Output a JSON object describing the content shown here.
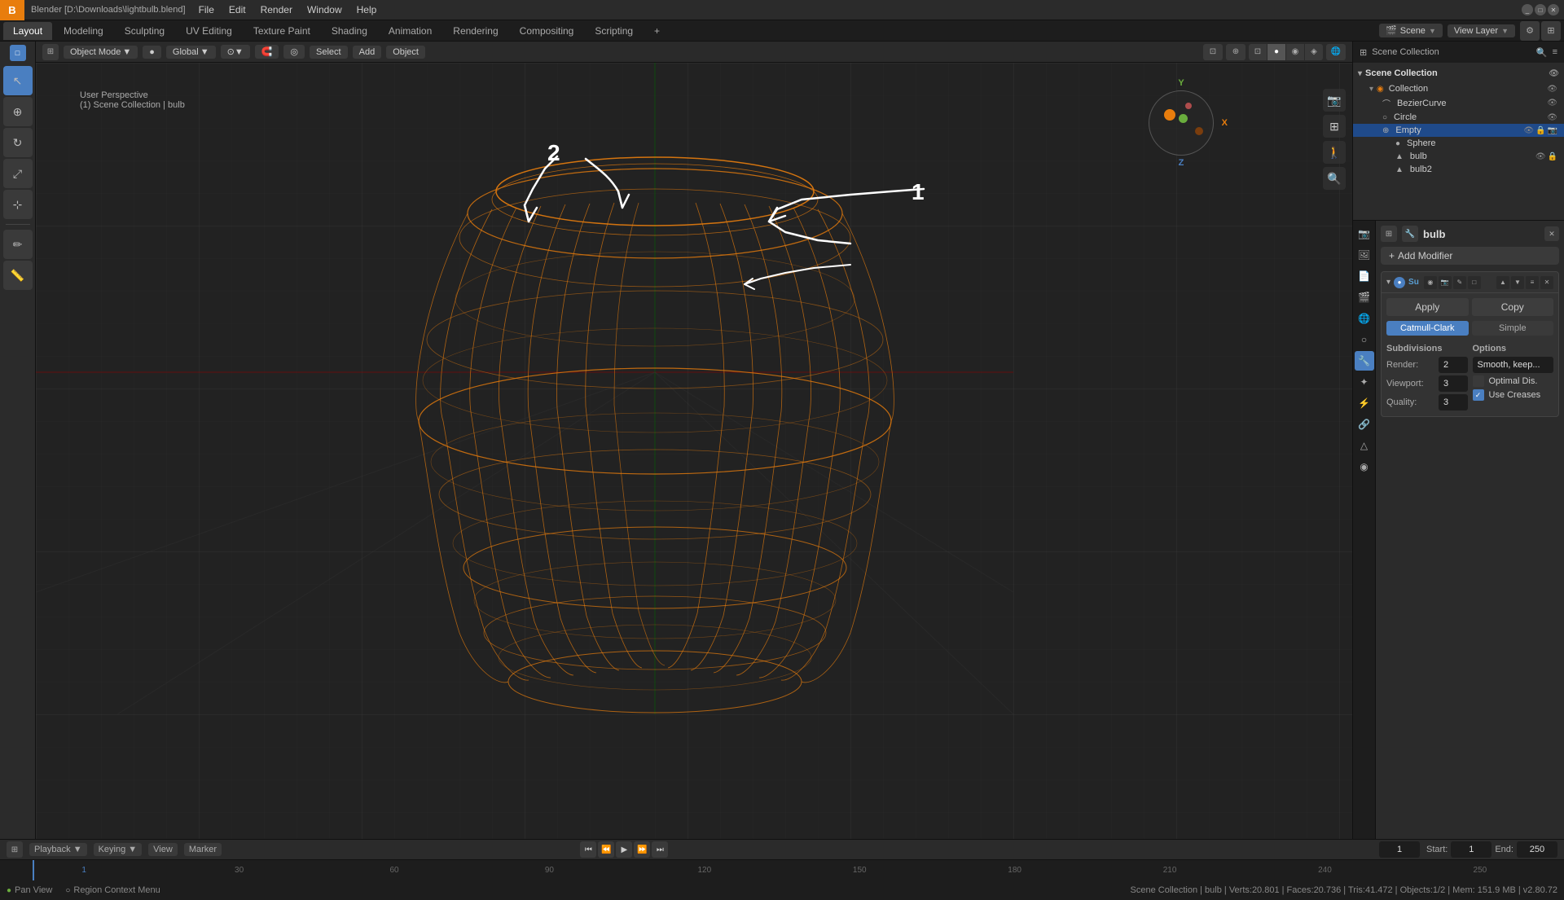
{
  "title": "Blender [D:\\Downloads\\lightbulb.blend]",
  "top_menu": {
    "logo": "B",
    "items": [
      "File",
      "Edit",
      "Render",
      "Window",
      "Help"
    ]
  },
  "workspace_tabs": {
    "tabs": [
      {
        "label": "Layout",
        "active": true
      },
      {
        "label": "Modeling"
      },
      {
        "label": "Sculpting"
      },
      {
        "label": "UV Editing"
      },
      {
        "label": "Texture Paint"
      },
      {
        "label": "Shading"
      },
      {
        "label": "Animation"
      },
      {
        "label": "Rendering"
      },
      {
        "label": "Compositing"
      },
      {
        "label": "Scripting"
      },
      {
        "label": "+"
      }
    ],
    "view_layer": "View Layer",
    "scene": "Scene"
  },
  "viewport": {
    "mode": "Object Mode",
    "header_btns": [
      "Object Mode",
      "Global",
      "Select",
      "Add",
      "Object"
    ],
    "info": {
      "line1": "User Perspective",
      "line2": "(1) Scene Collection | bulb"
    }
  },
  "outliner": {
    "title": "Scene Collection",
    "items": [
      {
        "name": "Collection",
        "type": "collection",
        "indent": 0
      },
      {
        "name": "BezierCurve",
        "type": "curve",
        "indent": 1
      },
      {
        "name": "Circle",
        "type": "mesh",
        "indent": 1
      },
      {
        "name": "Empty",
        "type": "empty",
        "indent": 1,
        "selected": true
      },
      {
        "name": "Sphere",
        "type": "mesh",
        "indent": 2
      },
      {
        "name": "bulb",
        "type": "mesh",
        "indent": 2
      },
      {
        "name": "bulb2",
        "type": "mesh",
        "indent": 2
      }
    ]
  },
  "properties": {
    "object_name": "bulb",
    "modifier_section": {
      "title": "Add Modifier",
      "modifier": {
        "name": "Subdivision Surface",
        "icon": "Su",
        "apply_label": "Apply",
        "copy_label": "Copy",
        "type_tabs": [
          {
            "label": "Catmull-Clark",
            "active": true
          },
          {
            "label": "Simple"
          }
        ],
        "subdivisions": {
          "title": "Subdivisions",
          "render_label": "Render:",
          "render_val": "2",
          "viewport_label": "Viewport:",
          "viewport_val": "3",
          "quality_label": "Quality:",
          "quality_val": "3"
        },
        "options": {
          "title": "Options",
          "smooth_label": "Smooth, keep...",
          "optimal_dis_label": "Optimal Dis.",
          "use_creases_label": "Use Creases",
          "optimal_checked": false,
          "use_creases_checked": true
        }
      }
    }
  },
  "timeline": {
    "buttons": [
      "Playback",
      "Keying",
      "View",
      "Marker"
    ],
    "frame_current": "1",
    "frame_start": "1",
    "frame_end": "250",
    "numbers": [
      "1",
      "30",
      "60",
      "90",
      "120",
      "150",
      "180",
      "210",
      "240",
      "250"
    ]
  },
  "status_bar": {
    "info1": "Pan View",
    "info2": "Region Context Menu",
    "stats": "Scene Collection | bulb | Verts:20.801 | Faces:20.736 | Tris:41.472 | Objects:1/2 | Mem: 151.9 MB | v2.80.72"
  }
}
